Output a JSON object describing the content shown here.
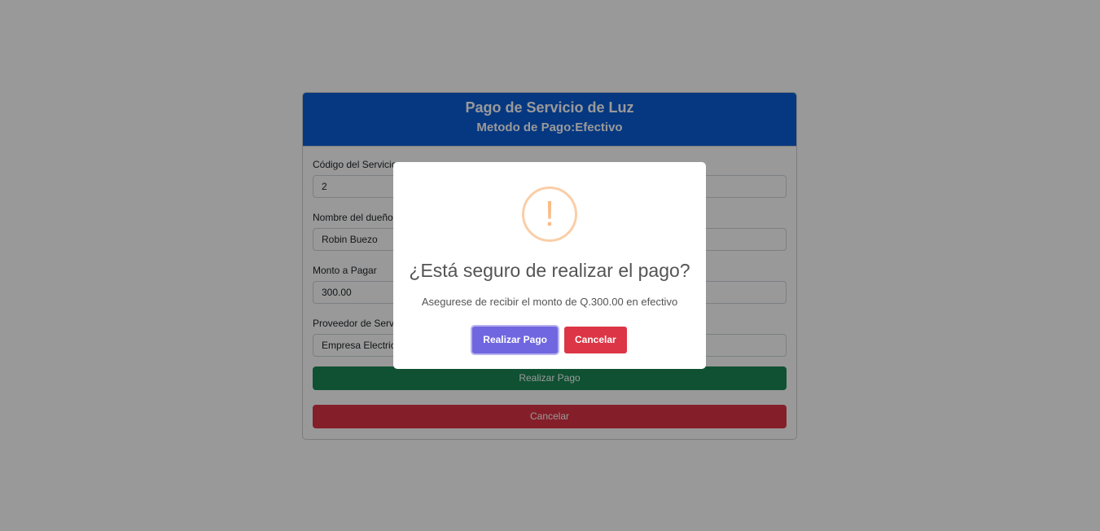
{
  "card": {
    "title": "Pago de Servicio de Luz",
    "subtitle": "Metodo de Pago:Efectivo",
    "fields": [
      {
        "label": "Código del Servicio",
        "value": "2"
      },
      {
        "label": "Nombre del dueño",
        "value": "Robin Buezo"
      },
      {
        "label": "Monto a Pagar",
        "value": "300.00"
      },
      {
        "label": "Proveedor de Servicio",
        "value": "Empresa Electrica"
      }
    ],
    "submit_label": "Realizar Pago",
    "cancel_label": "Cancelar"
  },
  "modal": {
    "icon": "!",
    "title": "¿Está seguro de realizar el pago?",
    "text": "Asegurese de recibir el monto de Q.300.00 en efectivo",
    "confirm_label": "Realizar Pago",
    "cancel_label": "Cancelar"
  },
  "colors": {
    "header": "#0b5ed7",
    "success": "#198754",
    "danger": "#dc3545",
    "confirm": "#7066e0",
    "warning_icon": "#f8bb86"
  }
}
